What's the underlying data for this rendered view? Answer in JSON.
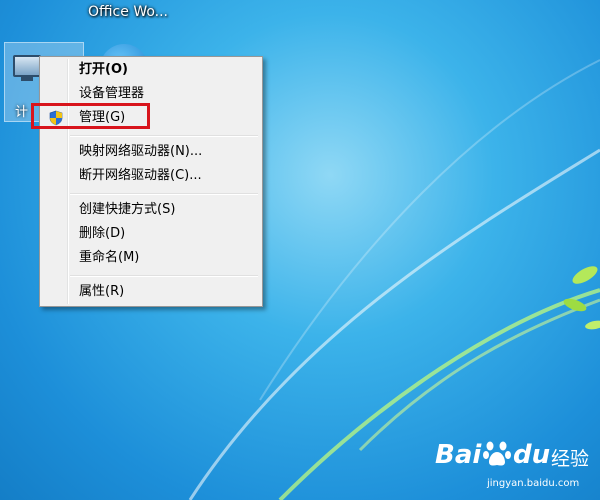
{
  "desktop": {
    "top_icon_label": "Office Wo...",
    "computer_icon_label": "计"
  },
  "context_menu": {
    "items": [
      {
        "label": "打开(O)",
        "bold": true
      },
      {
        "label": "设备管理器"
      },
      {
        "label": "管理(G)",
        "icon": "uac-shield-icon",
        "highlighted": true
      },
      {
        "label": "映射网络驱动器(N)..."
      },
      {
        "label": "断开网络驱动器(C)..."
      },
      {
        "label": "创建快捷方式(S)"
      },
      {
        "label": "删除(D)"
      },
      {
        "label": "重命名(M)"
      },
      {
        "label": "属性(R)"
      }
    ]
  },
  "watermark": {
    "brand_bai": "Bai",
    "brand_du": "du",
    "brand_jingyan": "经验",
    "url": "jingyan.baidu.com"
  },
  "colors": {
    "highlight": "#d8141c",
    "menu_bg": "#f0f0f0",
    "desktop_blue": "#1d8fd9"
  }
}
